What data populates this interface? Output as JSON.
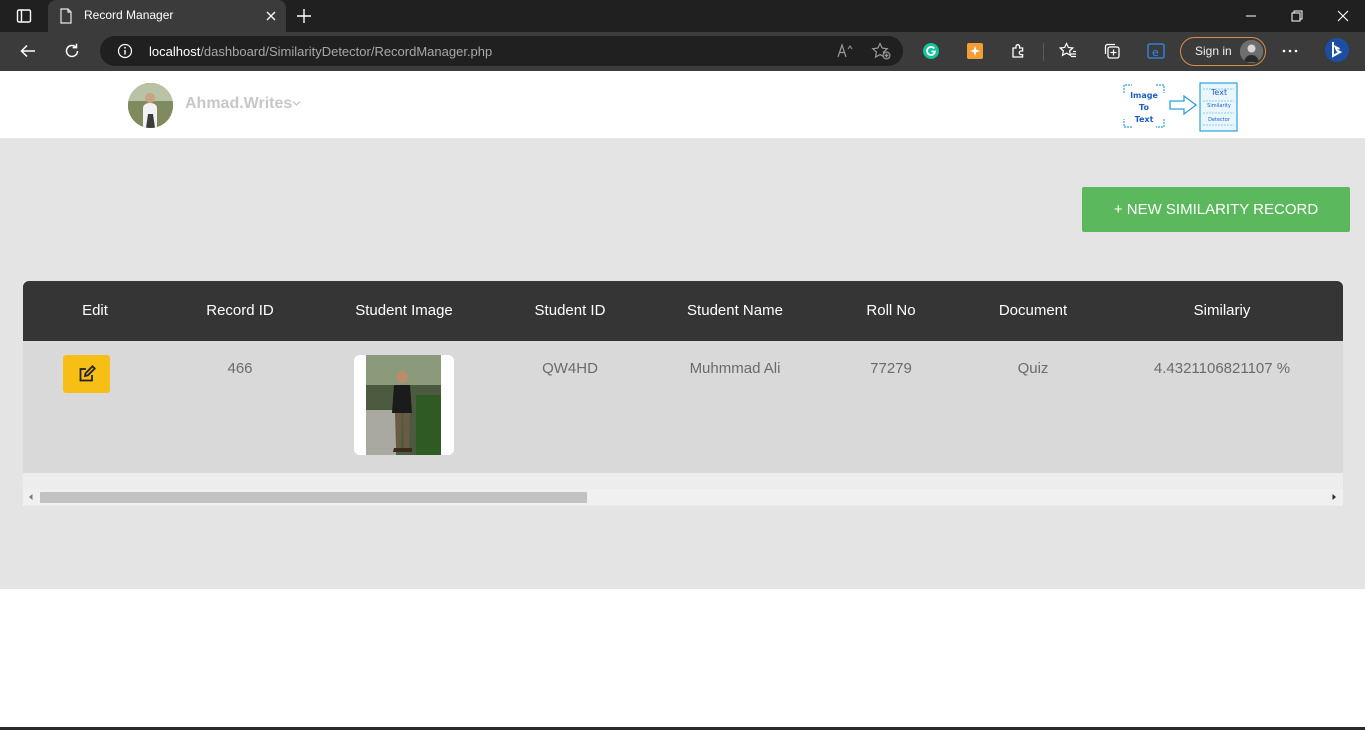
{
  "browser": {
    "tab": {
      "title": "Record Manager",
      "icon": "page-icon"
    },
    "address": {
      "host": "localhost",
      "path": "/dashboard/SimilarityDetector/RecordManager.php"
    },
    "sign_in_label": "Sign in",
    "accent_colors": {
      "signin_border": "#d4904a",
      "grammarly": "#15c39a",
      "bing": "#2e8ef0"
    }
  },
  "header": {
    "profile_name": "Ahmad.Writes",
    "logo": {
      "left_text_lines": [
        "Image",
        "To",
        "Text"
      ],
      "right_text_lines": [
        "Text",
        "Similarity",
        "Detector"
      ]
    }
  },
  "actions": {
    "new_record_label": "+ NEW SIMILARITY RECORD",
    "button_color": "#5cb85c"
  },
  "table": {
    "columns": [
      "Edit",
      "Record ID",
      "Student Image",
      "Student ID",
      "Student Name",
      "Roll No",
      "Document",
      "Similariy"
    ],
    "rows": [
      {
        "record_id": "466",
        "student_id": "QW4HD",
        "student_name": "Muhmmad Ali",
        "roll_no": "77279",
        "document": "Quiz",
        "similarity": "4.4321106821107 %"
      }
    ],
    "header_color": "#353535",
    "edit_button_color": "#f7be16"
  },
  "scrollbar": {
    "scroll_position": 0
  }
}
